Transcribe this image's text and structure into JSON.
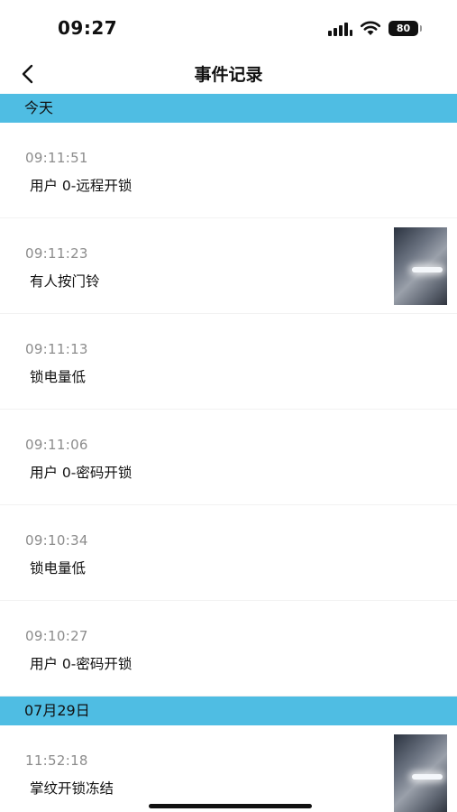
{
  "status_bar": {
    "time": "09:27",
    "battery": "80"
  },
  "nav": {
    "title": "事件记录"
  },
  "sections": [
    {
      "label": "今天"
    },
    {
      "label": "07月29日"
    }
  ],
  "events": [
    {
      "time": "09:11:51",
      "description": "用户 0-远程开锁",
      "has_thumbnail": false
    },
    {
      "time": "09:11:23",
      "description": "有人按门铃",
      "has_thumbnail": true
    },
    {
      "time": "09:11:13",
      "description": "锁电量低",
      "has_thumbnail": false
    },
    {
      "time": "09:11:06",
      "description": "用户 0-密码开锁",
      "has_thumbnail": false
    },
    {
      "time": "09:10:34",
      "description": "锁电量低",
      "has_thumbnail": false
    },
    {
      "time": "09:10:27",
      "description": "用户 0-密码开锁",
      "has_thumbnail": false
    },
    {
      "time": "11:52:18",
      "description": "掌纹开锁冻结",
      "has_thumbnail": true
    }
  ],
  "colors": {
    "section_header": "#4fbde3",
    "time_text": "#8c8c8c"
  }
}
